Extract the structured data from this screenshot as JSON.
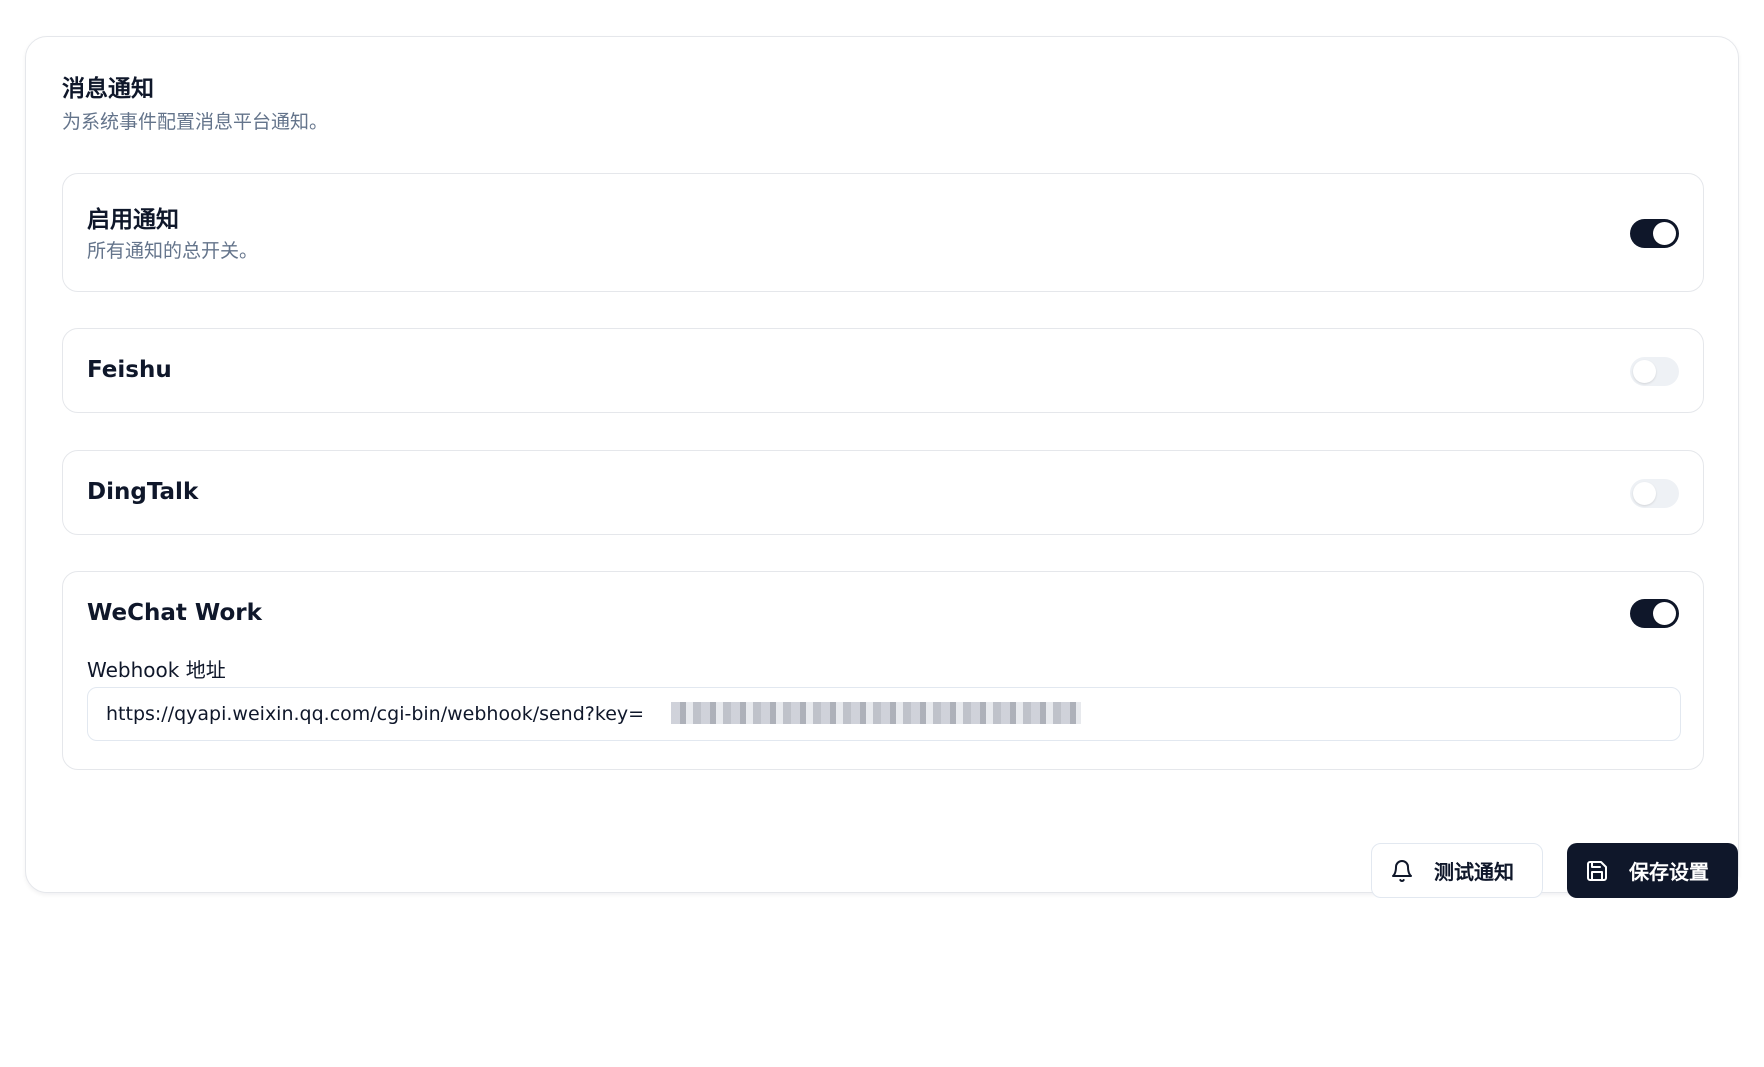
{
  "header": {
    "title": "消息通知",
    "description": "为系统事件配置消息平台通知。"
  },
  "master": {
    "title": "启用通知",
    "description": "所有通知的总开关。",
    "enabled": true
  },
  "channels": {
    "feishu": {
      "name": "Feishu",
      "enabled": false
    },
    "dingtalk": {
      "name": "DingTalk",
      "enabled": false
    },
    "wechat": {
      "name": "WeChat Work",
      "enabled": true,
      "webhook_label": "Webhook 地址",
      "webhook_value": "https://qyapi.weixin.qq.com/cgi-bin/webhook/send?key="
    }
  },
  "actions": {
    "test_label": "测试通知",
    "test_icon": "bell-icon",
    "save_label": "保存设置",
    "save_icon": "save-icon"
  },
  "colors": {
    "primary": "#0f172a",
    "muted_text": "#64748b",
    "border": "#e5e7eb",
    "toggle_off": "#eef1f5"
  }
}
